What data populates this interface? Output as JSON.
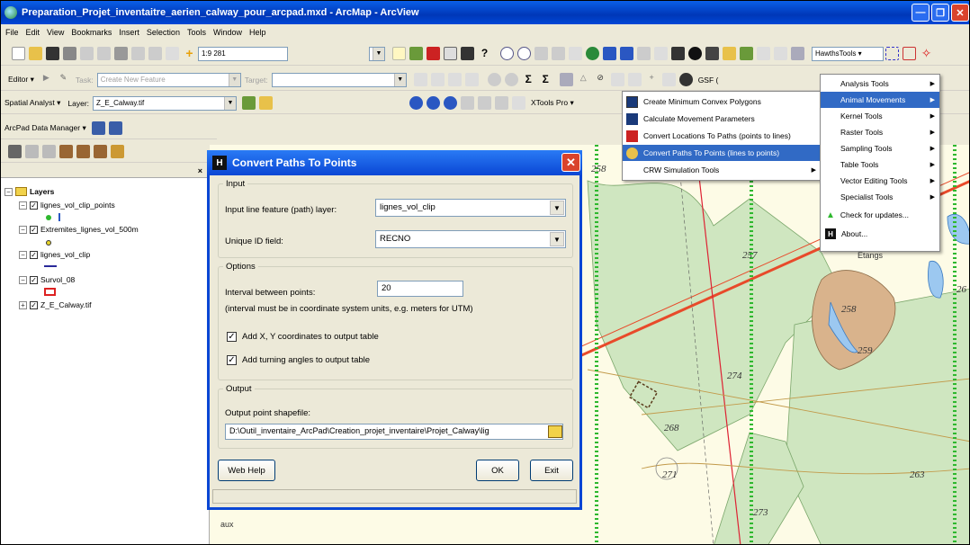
{
  "window": {
    "title": "Preparation_Projet_inventaitre_aerien_calway_pour_arcpad.mxd - ArcMap - ArcView"
  },
  "menubar": [
    "File",
    "Edit",
    "View",
    "Bookmarks",
    "Insert",
    "Selection",
    "Tools",
    "Window",
    "Help"
  ],
  "standard_toolbar": {
    "scale": "1:9 281",
    "hawths_label": "HawthsTools ▾"
  },
  "editor_toolbar": {
    "editor_label": "Editor ▾",
    "task_label": "Task:",
    "task_value": "Create New Feature",
    "target_label": "Target:",
    "gsf_label": "GSF ("
  },
  "spatial_toolbar": {
    "spatial_label": "Spatial Analyst ▾",
    "layer_label": "Layer:",
    "layer_value": "Z_E_Calway.tif",
    "xtools_label": "XTools Pro ▾"
  },
  "arcpad_toolbar": {
    "label": "ArcPad Data Manager ▾"
  },
  "toc": {
    "root": "Layers",
    "layers": [
      {
        "name": "lignes_vol_clip_points"
      },
      {
        "name": "Extremites_lignes_vol_500m"
      },
      {
        "name": "lignes_vol_clip"
      },
      {
        "name": "Survol_08"
      },
      {
        "name": "Z_E_Calway.tif"
      }
    ]
  },
  "dialog": {
    "title": "Convert Paths To Points",
    "input_legend": "Input",
    "input_layer_label": "Input line feature (path) layer:",
    "input_layer_value": "lignes_vol_clip",
    "unique_id_label": "Unique ID field:",
    "unique_id_value": "RECNO",
    "options_legend": "Options",
    "interval_label": "Interval between points:",
    "interval_value": "20",
    "interval_note": "(interval must be in coordinate system units, e.g. meters for UTM)",
    "add_xy_label": "Add X, Y coordinates to output table",
    "add_angles_label": "Add turning angles to output table",
    "output_legend": "Output",
    "output_label": "Output point shapefile:",
    "output_value": "D:\\Outil_inventaire_ArcPad\\Creation_projet_inventaire\\Projet_Calway\\lig",
    "web_help": "Web Help",
    "ok": "OK",
    "exit": "Exit"
  },
  "hawths_menu": [
    "Analysis Tools",
    "Animal Movements",
    "Kernel Tools",
    "Raster Tools",
    "Sampling Tools",
    "Table Tools",
    "Vector Editing Tools",
    "Specialist Tools",
    "Check for updates...",
    "About..."
  ],
  "animal_movements_menu": [
    "Create Minimum Convex Polygons",
    "Calculate Movement Parameters",
    "Convert Locations To Paths (points to lines)",
    "Convert Paths To Points (lines to points)",
    "CRW Simulation Tools"
  ],
  "map": {
    "elevations": [
      "258",
      "257",
      "258",
      "259",
      "274",
      "268",
      "271",
      "263",
      "273",
      "26"
    ],
    "places": [
      "Etangs",
      "aux"
    ]
  }
}
